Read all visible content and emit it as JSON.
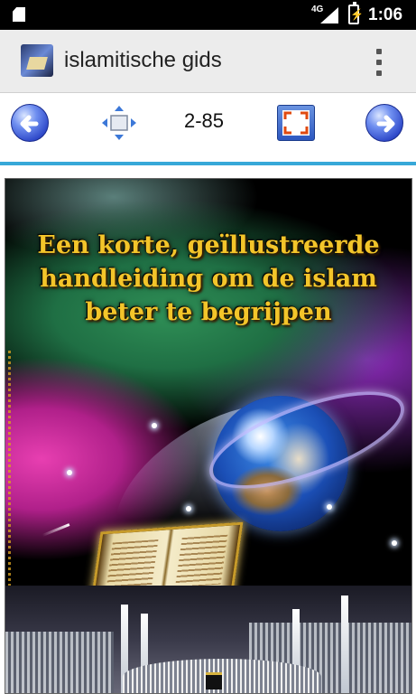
{
  "status_bar": {
    "network": "4G",
    "time": "1:06"
  },
  "app_bar": {
    "title": "islamitische gids"
  },
  "toolbar": {
    "page_indicator": "2-85"
  },
  "cover": {
    "headline": "Een korte, geïllustreerde handleiding om de islam beter te begrijpen"
  }
}
